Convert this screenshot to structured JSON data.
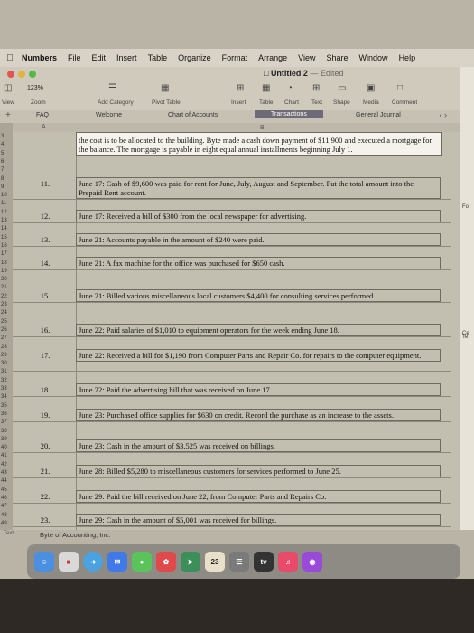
{
  "menubar": {
    "apple": "",
    "items": [
      "Numbers",
      "File",
      "Edit",
      "Insert",
      "Table",
      "Organize",
      "Format",
      "Arrange",
      "View",
      "Share",
      "Window",
      "Help"
    ]
  },
  "toolbar": {
    "doc_title": "Untitled 2",
    "edited": " — Edited",
    "zoom_value": "123%",
    "zoom_label": "Zoom",
    "view_label": "View",
    "add_category": "Add Category",
    "pivot_table": "Pivot Table",
    "insert": "Insert",
    "table": "Table",
    "chart": "Chart",
    "text": "Text",
    "shape": "Shape",
    "media": "Media",
    "comment": "Comment"
  },
  "tabs": {
    "items": [
      "FAQ",
      "Welcome",
      "Chart of Accounts",
      "Transactions",
      "General Journal"
    ],
    "active": "Transactions"
  },
  "sheet": {
    "col_a": "A",
    "col_b": "B",
    "top_text": "the cost is to be allocated to the building. Byte made a cash down payment of $11,900 and executed a mortgage for the balance. The mortgage is payable in eight equal annual installments beginning July 1.",
    "rows": [
      {
        "n": "11.",
        "t": "June 17: Cash of $9,600 was paid for rent for June, July, August and September. Put the total amount into the Prepaid Rent account."
      },
      {
        "n": "12.",
        "t": "June 17: Received a bill of $300 from the local newspaper for advertising."
      },
      {
        "n": "13.",
        "t": "June 21: Accounts payable in the amount of $240 were paid."
      },
      {
        "n": "14.",
        "t": "June 21: A fax machine for the office was purchased for $650 cash."
      },
      {
        "n": "15.",
        "t": "June 21: Billed various miscellaneous local customers $4,400 for consulting services performed."
      },
      {
        "n": "16.",
        "t": "June 22: Paid salaries of $1,010 to equipment operators for the week ending June 18."
      },
      {
        "n": "17.",
        "t": "June 22: Received a bill for $1,190 from Computer Parts and Repair Co. for repairs to the computer equipment."
      },
      {
        "n": "18.",
        "t": "June 22: Paid the advertising bill that was received on June 17."
      },
      {
        "n": "19.",
        "t": "June 23: Purchased office supplies for $630 on credit. Record the purchase as an increase to the assets."
      },
      {
        "n": "20.",
        "t": "June 23: Cash in the amount of $3,525 was received on billings."
      },
      {
        "n": "21.",
        "t": "June 28: Billed $5,280 to miscellaneous customers for services performed to June 25."
      },
      {
        "n": "22.",
        "t": "June 29: Paid the bill received on June 22, from Computer Parts and Repairs Co."
      },
      {
        "n": "23.",
        "t": "June 29: Cash in the amount of $5,001 was received for billings."
      }
    ],
    "row_numbers": [
      "3",
      "4",
      "5",
      "6",
      "7",
      "8",
      "9",
      "10",
      "11",
      "12",
      "13",
      "14",
      "15",
      "16",
      "17",
      "18",
      "19",
      "20",
      "21",
      "22",
      "23",
      "24",
      "25",
      "26",
      "27",
      "28",
      "29",
      "30",
      "31",
      "32",
      "33",
      "34",
      "35",
      "36",
      "37",
      "38",
      "39",
      "40",
      "41",
      "42",
      "43",
      "44",
      "45",
      "46",
      "47",
      "48",
      "49"
    ],
    "footer": "Byte of Accounting, Inc.",
    "footer_left": "Text"
  },
  "rstrip": {
    "labels": [
      "Fo",
      "Ce",
      "Te"
    ]
  },
  "dock": {
    "calendar_day": "23",
    "calendar_month": "JUN",
    "tv": "tv"
  }
}
